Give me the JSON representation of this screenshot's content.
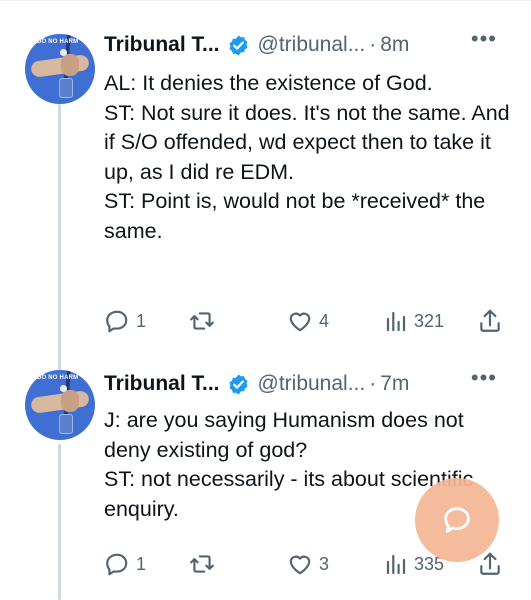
{
  "tweets": [
    {
      "author": "Tribunal T...",
      "handle": "@tribunal...",
      "separator": "·",
      "time": "8m",
      "avatar_text": "DO NO HARM",
      "text": "AL: It denies the existence of God.\nST: Not sure it does. It's not the same. And if S/O offended, wd expect then to take it up, as I did re EDM.\nST: Point is, would not be *received* the same.",
      "replies": "1",
      "likes": "4",
      "views": "321"
    },
    {
      "author": "Tribunal T...",
      "handle": "@tribunal...",
      "separator": "·",
      "time": "7m",
      "avatar_text": "DO NO HARM",
      "text": "J: are you saying Humanism does not deny existing of god?\nST: not necessarily - its about scientific enquiry.",
      "replies": "1",
      "likes": "3",
      "views": "335"
    }
  ],
  "icons": {
    "verified": "verified-badge-icon",
    "more": "more-dots-icon",
    "reply": "reply-icon",
    "retweet": "retweet-icon",
    "like": "heart-icon",
    "views": "views-chart-icon",
    "share": "share-icon",
    "fab": "compose-chat-icon"
  },
  "colors": {
    "verified": "#1d9bf0",
    "secondary_text": "#536471",
    "thread_line": "#cfd9de",
    "fab": "#f4b694"
  }
}
